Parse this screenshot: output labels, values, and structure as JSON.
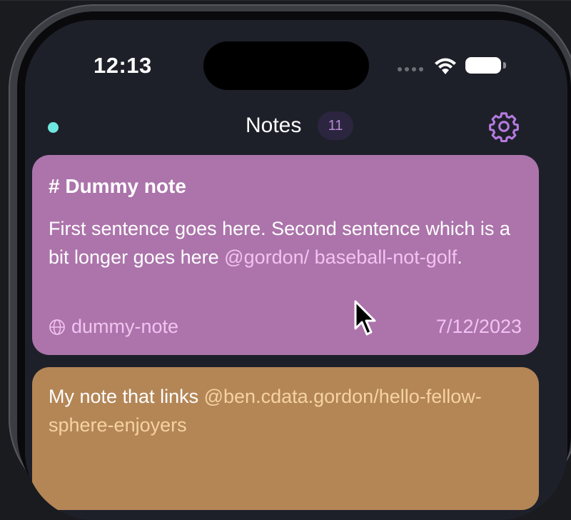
{
  "status_bar": {
    "time": "12:13"
  },
  "header": {
    "title": "Notes",
    "count": "11"
  },
  "notes": [
    {
      "title": "# Dummy note",
      "body_text": "First sentence goes here. Second sentence which is a bit longer goes here ",
      "mention": "@gordon/ baseball-not-golf",
      "body_end": ".",
      "slug": "dummy-note",
      "date": "7/12/2023",
      "color": "#ac74ab"
    },
    {
      "body_text": "My note that links ",
      "mention": "@ben.cdata.gordon/hello-fellow-sphere-enjoyers",
      "color": "#b48656"
    }
  ],
  "icons": {
    "status_dot": "status-dot",
    "settings": "gear-icon",
    "slug": "globe-icon",
    "wifi": "wifi-icon",
    "battery": "battery-icon"
  },
  "colors": {
    "accent_teal": "#6ee7e0",
    "accent_purple": "#b58ad2",
    "background": "#1e2029"
  }
}
